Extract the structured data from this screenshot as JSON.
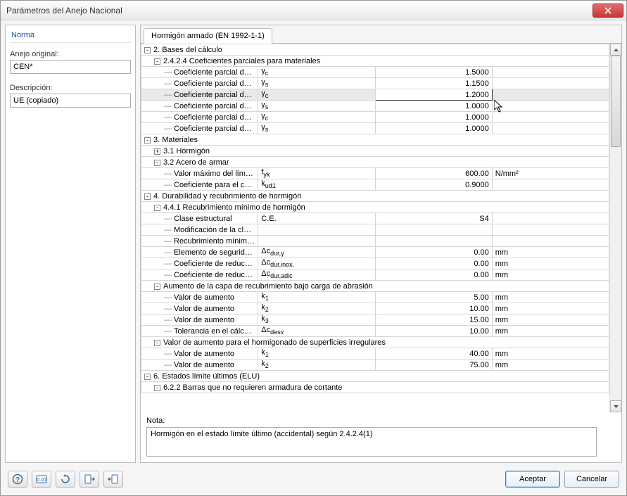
{
  "window": {
    "title": "Parámetros del Anejo Nacional"
  },
  "sidebar": {
    "norma_link": "Norma",
    "anejo_label": "Anejo original:",
    "anejo_value": "CEN*",
    "descripcion_label": "Descripción:",
    "descripcion_value": "UE (copiado)"
  },
  "tab": {
    "label": "Hormigón armado (EN 1992-1-1)"
  },
  "rows": [
    {
      "lvl": 1,
      "tog": "-",
      "desc": "2. Bases del cálculo",
      "span": true
    },
    {
      "lvl": 2,
      "tog": "-",
      "desc": "2.4.2.4 Coeficientes parciales para materiales",
      "span": true
    },
    {
      "lvl": 3,
      "leaf": true,
      "desc": "Coeficiente parcial del hormigón para el estado límite último (persistente, transitorio)",
      "sym": "γ<sub>c</sub>",
      "val": "1.5000",
      "unit": ""
    },
    {
      "lvl": 3,
      "leaf": true,
      "desc": "Coeficiente parcial del acero en el estado límite último (persistente, transitorio)",
      "sym": "γ<sub>s</sub>",
      "val": "1.1500",
      "unit": ""
    },
    {
      "lvl": 3,
      "leaf": true,
      "sel": true,
      "desc": "Coeficiente parcial del hormigón en el estado límite último (accidental)",
      "sym": "γ<sub>c</sub>",
      "val": "1.2000",
      "unit": ""
    },
    {
      "lvl": 3,
      "leaf": true,
      "desc": "Coeficiente parcial del acero en el estado límite último (accidental)",
      "sym": "γ<sub>s</sub>",
      "val": "1.0000",
      "unit": ""
    },
    {
      "lvl": 3,
      "leaf": true,
      "desc": "Coeficiente parcial del hormigón para el estado límite de servicio",
      "sym": "γ<sub>c</sub>",
      "val": "1.0000",
      "unit": ""
    },
    {
      "lvl": 3,
      "leaf": true,
      "desc": "Coeficiente parcial del acero en el estado límite de servicio",
      "sym": "γ<sub>s</sub>",
      "val": "1.0000",
      "unit": ""
    },
    {
      "lvl": 1,
      "tog": "-",
      "desc": "3. Materiales",
      "span": true
    },
    {
      "lvl": 2,
      "tog": "+",
      "desc": "3.1 Hormigón",
      "span": true
    },
    {
      "lvl": 2,
      "tog": "-",
      "desc": "3.2 Acero de armar",
      "span": true
    },
    {
      "lvl": 3,
      "leaf": true,
      "desc": "Valor máximo del límite elástico",
      "sym": "f<sub>yk</sub>",
      "val": "600.00",
      "unit": "N/mm²"
    },
    {
      "lvl": 3,
      "leaf": true,
      "desc": "Coeficiente para el cálculo del valor de cálculo para el alargamiento límite del acero",
      "sym": "k<sub>ud1</sub>",
      "val": "0.9000",
      "unit": ""
    },
    {
      "lvl": 1,
      "tog": "-",
      "desc": "4. Durabilidad y recubrimiento de hormigón",
      "span": true
    },
    {
      "lvl": 2,
      "tog": "-",
      "desc": "4.4.1 Recubrimiento mínimo de hormigón",
      "span": true
    },
    {
      "lvl": 3,
      "leaf": true,
      "desc": "Clase estructural",
      "sym": "C.E.",
      "val": "S4",
      "unit": ""
    },
    {
      "lvl": 3,
      "leaf": true,
      "desc": "Modificación de la clase estructural",
      "sym": "",
      "val": "",
      "unit": ""
    },
    {
      "lvl": 3,
      "leaf": true,
      "desc": "Recubrimiento mínimo de hormigón",
      "sym": "",
      "val": "",
      "unit": ""
    },
    {
      "lvl": 3,
      "leaf": true,
      "desc": "Elemento de seguridad adicional para el incremento del recubrimiento mínimo de hormigó",
      "sym": "Δc<sub>dur,γ</sub>",
      "val": "0.00",
      "unit": "mm"
    },
    {
      "lvl": 3,
      "leaf": true,
      "desc": "Coeficiente de reducción bajo el uso de acero inoxidable",
      "sym": "Δc<sub>dur,inox.</sub>",
      "val": "0.00",
      "unit": "mm"
    },
    {
      "lvl": 3,
      "leaf": true,
      "desc": "Coeficiente de reducción para el hormigón con protección adicional",
      "sym": "Δc<sub>dur,adic</sub>",
      "val": "0.00",
      "unit": "mm"
    },
    {
      "lvl": 2,
      "tog": "-",
      "desc": "Aumento de la capa de recubrimiento bajo carga de abrasión",
      "span": true
    },
    {
      "lvl": 3,
      "leaf": true,
      "desc": "Valor de aumento",
      "sym": "k<sub>1</sub>",
      "val": "5.00",
      "unit": "mm"
    },
    {
      "lvl": 3,
      "leaf": true,
      "desc": "Valor de aumento",
      "sym": "k<sub>2</sub>",
      "val": "10.00",
      "unit": "mm"
    },
    {
      "lvl": 3,
      "leaf": true,
      "desc": "Valor de aumento",
      "sym": "k<sub>3</sub>",
      "val": "15.00",
      "unit": "mm"
    },
    {
      "lvl": 3,
      "leaf": true,
      "desc": "Tolerancia en el cálculo para la desviación",
      "sym": "Δc<sub>desv</sub>",
      "val": "10.00",
      "unit": "mm"
    },
    {
      "lvl": 2,
      "tog": "-",
      "desc": "Valor de aumento para el hormigonado de superficies irregulares",
      "span": true
    },
    {
      "lvl": 3,
      "leaf": true,
      "desc": "Valor de aumento",
      "sym": "k<sub>1</sub>",
      "val": "40.00",
      "unit": "mm"
    },
    {
      "lvl": 3,
      "leaf": true,
      "desc": "Valor de aumento",
      "sym": "k<sub>2</sub>",
      "val": "75.00",
      "unit": "mm"
    },
    {
      "lvl": 1,
      "tog": "-",
      "desc": "6. Estados límite últimos (ELU)",
      "span": true
    },
    {
      "lvl": 2,
      "tog": "-",
      "desc": "6.2.2 Barras que no requieren armadura de cortante",
      "span": true
    }
  ],
  "nota": {
    "label": "Nota:",
    "text": "Hormigón en el estado límite último (accidental) según 2.4.2.4(1)"
  },
  "footer": {
    "aceptar": "Aceptar",
    "cancelar": "Cancelar"
  }
}
